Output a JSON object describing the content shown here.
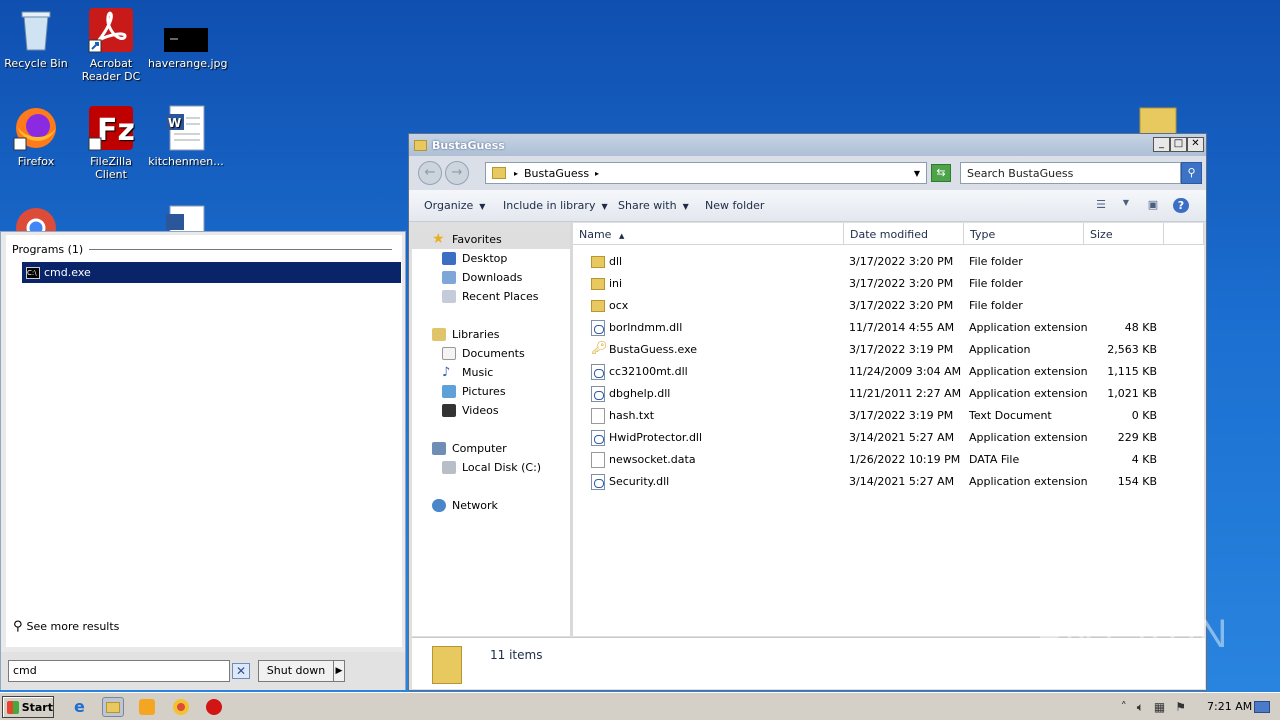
{
  "desktop": {
    "icons": [
      {
        "label": "Recycle Bin",
        "icon": "recycle-bin-icon"
      },
      {
        "label": "Acrobat Reader DC",
        "icon": "acrobat-icon"
      },
      {
        "label": "haverange.jpg",
        "icon": "image-file-icon"
      },
      {
        "label": "Firefox",
        "icon": "firefox-icon"
      },
      {
        "label": "FileZilla Client",
        "icon": "filezilla-icon"
      },
      {
        "label": "kitchenmen...",
        "icon": "word-doc-icon"
      }
    ]
  },
  "start_menu": {
    "section_label": "Programs (1)",
    "result": "cmd.exe",
    "see_more": "See more results",
    "search_value": "cmd",
    "shutdown_label": "Shut down"
  },
  "explorer": {
    "title": "BustaGuess",
    "address_crumb": "BustaGuess",
    "search_placeholder": "Search BustaGuess",
    "toolbar": {
      "organize": "Organize",
      "include": "Include in library",
      "share": "Share with",
      "newfolder": "New folder"
    },
    "nav": {
      "favorites": "Favorites",
      "desktop": "Desktop",
      "downloads": "Downloads",
      "recent": "Recent Places",
      "libraries": "Libraries",
      "documents": "Documents",
      "music": "Music",
      "pictures": "Pictures",
      "videos": "Videos",
      "computer": "Computer",
      "localdisk": "Local Disk (C:)",
      "network": "Network"
    },
    "columns": {
      "name": "Name",
      "date": "Date modified",
      "type": "Type",
      "size": "Size"
    },
    "files": [
      {
        "name": "dll",
        "date": "3/17/2022 3:20 PM",
        "type": "File folder",
        "size": "",
        "kind": "folder"
      },
      {
        "name": "ini",
        "date": "3/17/2022 3:20 PM",
        "type": "File folder",
        "size": "",
        "kind": "folder"
      },
      {
        "name": "ocx",
        "date": "3/17/2022 3:20 PM",
        "type": "File folder",
        "size": "",
        "kind": "folder"
      },
      {
        "name": "borlndmm.dll",
        "date": "11/7/2014 4:55 AM",
        "type": "Application extension",
        "size": "48 KB",
        "kind": "dll"
      },
      {
        "name": "BustaGuess.exe",
        "date": "3/17/2022 3:19 PM",
        "type": "Application",
        "size": "2,563 KB",
        "kind": "exe"
      },
      {
        "name": "cc32100mt.dll",
        "date": "11/24/2009 3:04 AM",
        "type": "Application extension",
        "size": "1,115 KB",
        "kind": "dll"
      },
      {
        "name": "dbghelp.dll",
        "date": "11/21/2011 2:27 AM",
        "type": "Application extension",
        "size": "1,021 KB",
        "kind": "dll"
      },
      {
        "name": "hash.txt",
        "date": "3/17/2022 3:19 PM",
        "type": "Text Document",
        "size": "0 KB",
        "kind": "txt"
      },
      {
        "name": "HwidProtector.dll",
        "date": "3/14/2021 5:27 AM",
        "type": "Application extension",
        "size": "229 KB",
        "kind": "dll"
      },
      {
        "name": "newsocket.data",
        "date": "1/26/2022 10:19 PM",
        "type": "DATA File",
        "size": "4 KB",
        "kind": "txt"
      },
      {
        "name": "Security.dll",
        "date": "3/14/2021 5:27 AM",
        "type": "Application extension",
        "size": "154 KB",
        "kind": "dll"
      }
    ],
    "status": "11 items"
  },
  "taskbar": {
    "start": "Start",
    "clock": "7:21 AM"
  },
  "watermark": "ANY RUN"
}
